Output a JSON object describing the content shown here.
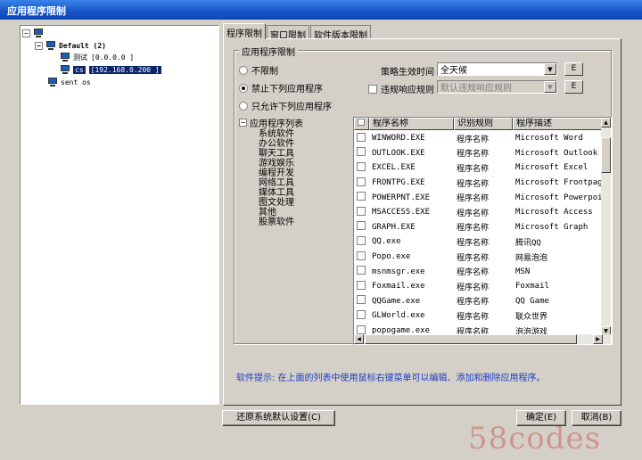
{
  "window": {
    "title": "应用程序限制"
  },
  "tree": {
    "root_label": "",
    "group_label": "Default (2)",
    "computers": [
      {
        "name": "测试",
        "ip": "[0.0.0.0       ]"
      },
      {
        "name": "cs",
        "ip": "[192.168.0.200  ]"
      }
    ],
    "extra_item": "sent os"
  },
  "tabs": [
    {
      "label": "程序限制",
      "active": true
    },
    {
      "label": "窗口限制",
      "active": false
    },
    {
      "label": "软件版本限制",
      "active": false
    }
  ],
  "group": {
    "title": "应用程序限制",
    "radios": [
      {
        "label": "不限制",
        "checked": false
      },
      {
        "label": "禁止下列应用程序",
        "checked": true
      },
      {
        "label": "只允许下列应用程序",
        "checked": false
      }
    ],
    "policy_time_label": "策略生效时间",
    "policy_time_value": "全天候",
    "violation_label": "违规响应规则",
    "violation_value": "默认违规响应规则",
    "edit_button": "E",
    "category_root": "应用程序列表",
    "categories": [
      "系统软件",
      "办公软件",
      "聊天工具",
      "游戏娱乐",
      "编程开发",
      "网络工具",
      "媒体工具",
      "图文处理",
      "其他",
      "股票软件"
    ]
  },
  "list": {
    "columns": [
      "",
      "程序名称",
      "识别规则",
      "程序描述"
    ],
    "rows": [
      {
        "name": "WINWORD.EXE",
        "rule": "程序名称",
        "desc": "Microsoft Word"
      },
      {
        "name": "OUTLOOK.EXE",
        "rule": "程序名称",
        "desc": "Microsoft Outlook"
      },
      {
        "name": "EXCEL.EXE",
        "rule": "程序名称",
        "desc": "Microsoft Excel"
      },
      {
        "name": "FRONTPG.EXE",
        "rule": "程序名称",
        "desc": "Microsoft Frontpage"
      },
      {
        "name": "POWERPNT.EXE",
        "rule": "程序名称",
        "desc": "Microsoft Powerpoint"
      },
      {
        "name": "MSACCESS.EXE",
        "rule": "程序名称",
        "desc": "Microsoft Access"
      },
      {
        "name": "GRAPH.EXE",
        "rule": "程序名称",
        "desc": "Microsoft Graph"
      },
      {
        "name": "QQ.exe",
        "rule": "程序名称",
        "desc": "腾讯QQ"
      },
      {
        "name": "Popo.exe",
        "rule": "程序名称",
        "desc": "网易泡泡"
      },
      {
        "name": "msnmsgr.exe",
        "rule": "程序名称",
        "desc": "MSN"
      },
      {
        "name": "Foxmail.exe",
        "rule": "程序名称",
        "desc": "Foxmail"
      },
      {
        "name": "QQGame.exe",
        "rule": "程序名称",
        "desc": "QQ Game"
      },
      {
        "name": "GLWorld.exe",
        "rule": "程序名称",
        "desc": "联众世界"
      },
      {
        "name": "popogame.exe",
        "rule": "程序名称",
        "desc": "泡泡游戏"
      }
    ]
  },
  "hint": "软件提示: 在上面的列表中使用鼠标右键菜单可以编辑、添加和删除应用程序。",
  "buttons": {
    "restore": "还原系统默认设置(C)",
    "ok": "确定(E)",
    "cancel": "取消(B)"
  },
  "watermark": "58codes"
}
